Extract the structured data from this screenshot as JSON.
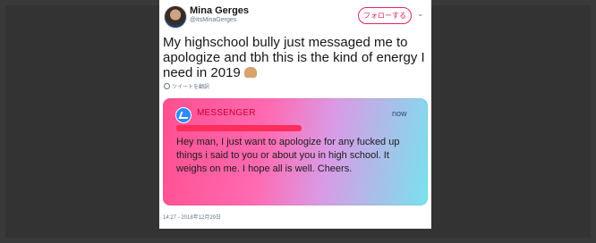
{
  "tweet": {
    "author_name": "Mina Gerges",
    "author_handle": "@itsMinaGerges",
    "follow_label": "フォローする",
    "text": "My highschool bully just messaged me to apologize and tbh this is the kind of energy I need in 2019",
    "translate_label": "ツイートを翻訳",
    "timestamp": "14:27 - 2018年12月29日"
  },
  "notification": {
    "app_name": "MESSENGER",
    "time": "now",
    "message": "Hey man, I just want to apologize for any fucked up things i said to you or about you in high school. It weighs on me. I hope all is well. Cheers."
  },
  "icons": [
    "avatar",
    "chevron-down-icon",
    "globe-icon",
    "messenger-icon",
    "emoji-raised-hands-icon"
  ]
}
